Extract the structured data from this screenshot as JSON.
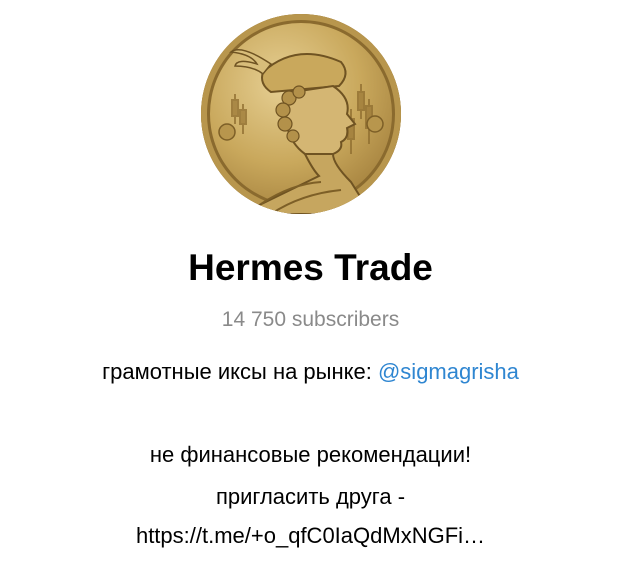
{
  "channel": {
    "avatar_icon": "hermes-coin-avatar",
    "title": "Hermes Trade",
    "subscribers": "14 750 subscribers"
  },
  "description": {
    "line1_text": "грамотные иксы на рынке: ",
    "line1_mention": "@sigmagrisha",
    "line2": "не финансовые рекомендации!",
    "line3": "пригласить друга -",
    "line4_link": "https://t.me/+o_qfC0IaQdMxNGFi…"
  },
  "colors": {
    "mention": "#2f86d1",
    "subscribers": "#8a8a8a"
  }
}
